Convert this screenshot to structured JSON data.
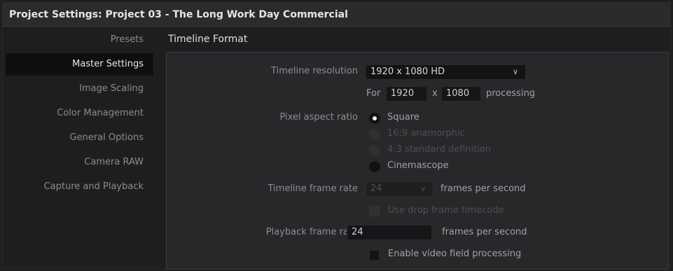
{
  "window": {
    "title": "Project Settings:  Project 03 - The Long Work Day Commercial"
  },
  "sidebar": {
    "items": [
      {
        "label": "Presets",
        "active": false
      },
      {
        "label": "Master Settings",
        "active": true
      },
      {
        "label": "Image Scaling",
        "active": false
      },
      {
        "label": "Color Management",
        "active": false
      },
      {
        "label": "General Options",
        "active": false
      },
      {
        "label": "Camera RAW",
        "active": false
      },
      {
        "label": "Capture and Playback",
        "active": false
      }
    ]
  },
  "main": {
    "section_title": "Timeline Format",
    "timeline_resolution": {
      "label": "Timeline resolution",
      "value": "1920 x 1080 HD"
    },
    "processing": {
      "prefix": "For",
      "width": "1920",
      "separator": "x",
      "height": "1080",
      "suffix": "processing"
    },
    "pixel_aspect_ratio": {
      "label": "Pixel aspect ratio",
      "options": [
        {
          "label": "Square",
          "selected": true,
          "enabled": true
        },
        {
          "label": "16:9 anamorphic",
          "selected": false,
          "enabled": false
        },
        {
          "label": "4:3 standard definition",
          "selected": false,
          "enabled": false
        },
        {
          "label": "Cinemascope",
          "selected": false,
          "enabled": true
        }
      ]
    },
    "timeline_frame_rate": {
      "label": "Timeline frame rate",
      "value": "24",
      "unit": "frames per second"
    },
    "drop_frame": {
      "label": "Use drop frame timecode",
      "checked": false,
      "enabled": false
    },
    "playback_frame_rate": {
      "label": "Playback frame rate",
      "value": "24",
      "unit": "frames per second"
    },
    "video_field": {
      "label": "Enable video field processing",
      "checked": false,
      "enabled": true
    }
  }
}
